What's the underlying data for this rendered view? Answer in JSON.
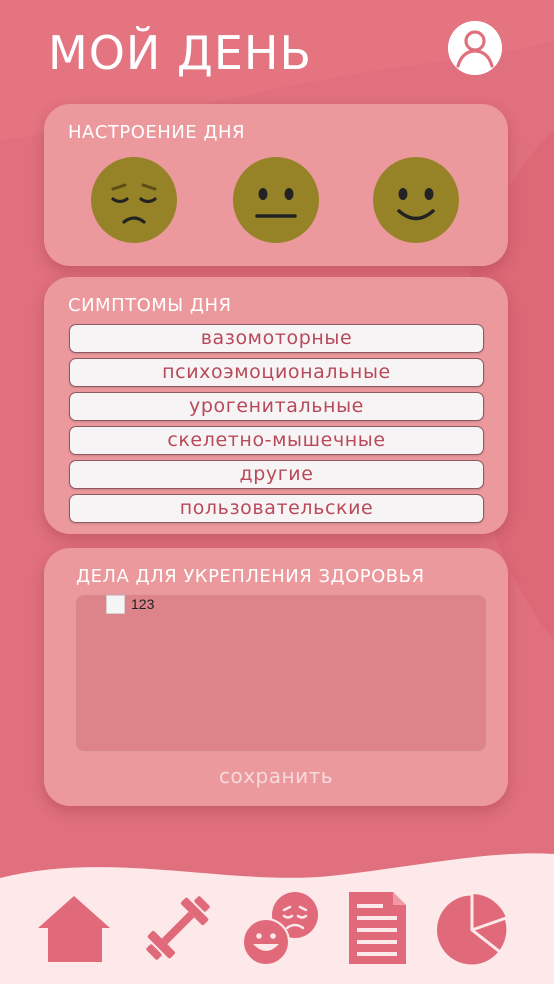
{
  "header": {
    "title": "МОЙ ДЕНЬ"
  },
  "mood_card": {
    "title": "НАСТРОЕНИЕ ДНЯ",
    "moods": [
      {
        "icon": "sad-face-icon"
      },
      {
        "icon": "neutral-face-icon"
      },
      {
        "icon": "happy-face-icon"
      }
    ]
  },
  "symptoms_card": {
    "title": "СИМПТОМЫ ДНЯ",
    "items": [
      "вазомоторные",
      "психоэмоциональные",
      "урогенитальные",
      "скелетно-мышечные",
      "другие",
      "пользовательские"
    ]
  },
  "health_card": {
    "title": "ДЕЛА ДЛЯ УКРЕПЛЕНИЯ ЗДОРОВЬЯ",
    "tasks": [
      {
        "label": "123",
        "checked": false
      }
    ],
    "save_label": "сохранить"
  },
  "nav": {
    "items": [
      {
        "icon": "home-icon"
      },
      {
        "icon": "dumbbell-icon"
      },
      {
        "icon": "moods-icon"
      },
      {
        "icon": "document-icon"
      },
      {
        "icon": "pie-chart-icon"
      }
    ]
  },
  "colors": {
    "background": "#e0707e",
    "card": "#ec999e",
    "accent": "#e06a7a",
    "face": "#968328",
    "nav_bg": "#fde8ea"
  }
}
